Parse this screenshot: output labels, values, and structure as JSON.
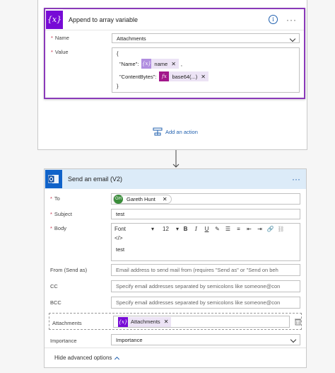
{
  "append_card": {
    "title": "Append to array variable",
    "icon": "{x}",
    "name_label": "Name",
    "name_value": "Attachments",
    "value_label": "Value",
    "json_open": "{",
    "json_name_key": "\"Name\":",
    "json_content_key": "\"ContentBytes\":",
    "json_close": "}",
    "comma": ",",
    "name_token": "name",
    "content_token": "base64(...)",
    "name_token_icon": "{x}",
    "content_token_icon": "fx"
  },
  "add_action_label": "Add an action",
  "email_card": {
    "title": "Send an email (V2)",
    "to_label": "To",
    "to_avatar": "GH",
    "to_value": "Gareth Hunt",
    "subject_label": "Subject",
    "subject_value": "test",
    "body_label": "Body",
    "font_value": "Font",
    "size_value": "12",
    "code_btn": "</>",
    "body_text": "test",
    "from_label": "From (Send as)",
    "from_placeholder": "Email address to send mail from (requires \"Send as\" or \"Send on beh",
    "cc_label": "CC",
    "cc_placeholder": "Specify email addresses separated by semicolons like someone@con",
    "bcc_label": "BCC",
    "bcc_placeholder": "Specify email addresses separated by semicolons like someone@con",
    "attachments_label": "Attachments",
    "attachments_token": "Attachments",
    "attachments_token_icon": "{x}",
    "importance_label": "Importance",
    "importance_value": "Importance",
    "hide_advanced": "Hide advanced options"
  },
  "colors": {
    "variable": "#770bd6",
    "accent": "#8a3ab9",
    "link": "#1f5fae",
    "outlook": "#0f62c9",
    "required": "#c4314b",
    "expression": "#a2168b"
  }
}
